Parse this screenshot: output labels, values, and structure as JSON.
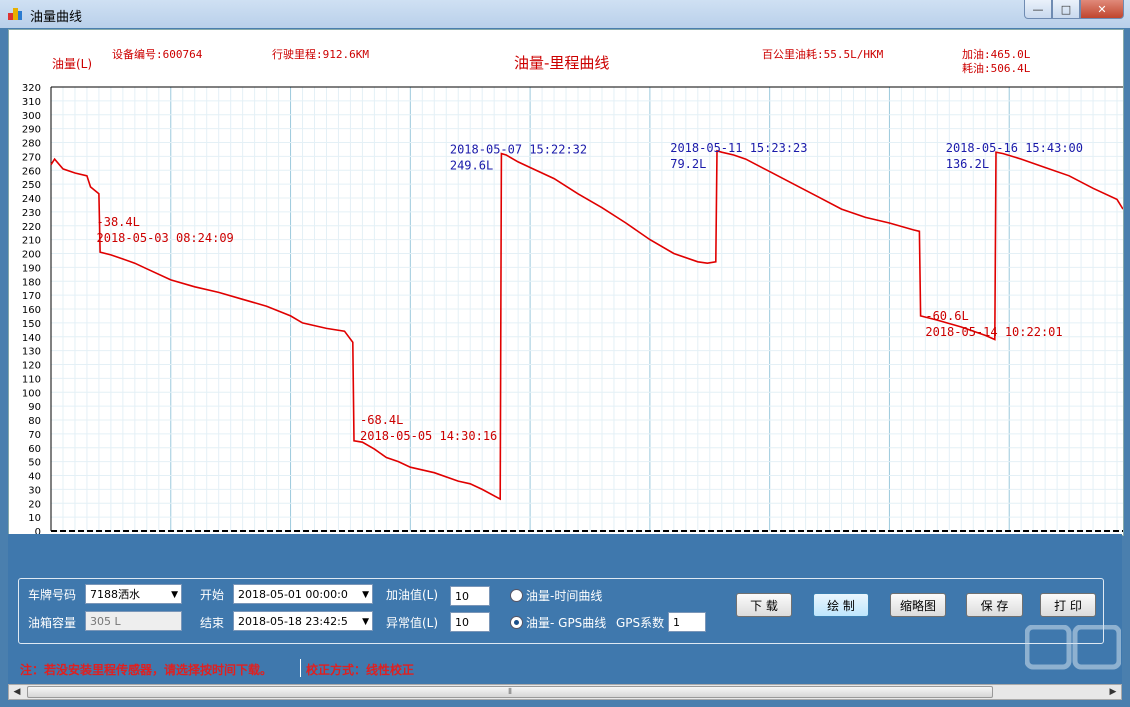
{
  "window": {
    "title": "油量曲线",
    "buttons": {
      "minimize": "—",
      "maximize": "□",
      "close": "✕"
    }
  },
  "header": {
    "y_unit_label": "油量(L)",
    "device": "设备编号:600764",
    "mileage": "行驶里程:912.6KM",
    "chart_title": "油量-里程曲线",
    "consumption": "百公里油耗:55.5L/HKM",
    "refuel_total": "加油:465.0L",
    "used_total": "耗油:506.4L"
  },
  "chart_data": {
    "type": "line",
    "xlim": [
      0,
      895
    ],
    "ylim": [
      0,
      320
    ],
    "x_ticks": [
      0,
      100,
      200,
      300,
      400,
      500,
      600,
      700,
      800
    ],
    "y_ticks": [
      0,
      10,
      20,
      30,
      40,
      50,
      60,
      70,
      80,
      90,
      100,
      110,
      120,
      130,
      140,
      150,
      160,
      170,
      180,
      190,
      200,
      210,
      220,
      230,
      240,
      250,
      260,
      270,
      280,
      290,
      300,
      310,
      320
    ],
    "grid": true,
    "line_color": "#e00000",
    "series": [
      {
        "x": [
          0,
          3,
          10,
          20,
          30,
          33,
          40,
          41,
          50,
          60,
          70,
          80,
          100,
          120,
          140,
          160,
          180,
          200,
          210,
          230,
          245,
          252,
          253,
          260,
          270,
          280,
          290,
          300,
          320,
          340,
          350,
          360,
          375,
          376,
          380,
          390,
          400,
          420,
          440,
          460,
          480,
          500,
          520,
          540,
          548,
          555,
          556,
          560,
          570,
          580,
          600,
          620,
          640,
          660,
          680,
          700,
          720,
          725,
          726,
          740,
          760,
          780,
          788,
          789,
          795,
          810,
          830,
          850,
          870,
          890,
          895
        ],
        "y": [
          264,
          268,
          261,
          258,
          256,
          248,
          243,
          201,
          199,
          196,
          193,
          189,
          181,
          176,
          172,
          167,
          162,
          155,
          150,
          146,
          144,
          136,
          65,
          64,
          59,
          53,
          50,
          46,
          42,
          36,
          34,
          30,
          23,
          272,
          271,
          266,
          262,
          254,
          243,
          233,
          222,
          210,
          200,
          194,
          193,
          194,
          274,
          273,
          271,
          268,
          259,
          250,
          241,
          232,
          226,
          222,
          217,
          216,
          155,
          152,
          147,
          141,
          138,
          273,
          272,
          268,
          262,
          256,
          247,
          239,
          232
        ]
      }
    ],
    "annotations": [
      {
        "x": 38,
        "y": 220,
        "color": "#cc0000",
        "lines": [
          "-38.4L",
          "2018-05-03 08:24:09"
        ]
      },
      {
        "x": 258,
        "y": 77,
        "color": "#cc0000",
        "lines": [
          "-68.4L",
          "2018-05-05 14:30:16"
        ]
      },
      {
        "x": 333,
        "y": 272,
        "color": "#1a1aaa",
        "lines": [
          "2018-05-07 15:22:32",
          "249.6L"
        ]
      },
      {
        "x": 517,
        "y": 273,
        "color": "#1a1aaa",
        "lines": [
          "2018-05-11 15:23:23",
          "79.2L"
        ]
      },
      {
        "x": 730,
        "y": 152,
        "color": "#cc0000",
        "lines": [
          "-60.6L",
          "2018-05-14 10:22:01"
        ]
      },
      {
        "x": 747,
        "y": 273,
        "color": "#1a1aaa",
        "lines": [
          "2018-05-16 15:43:00",
          "136.2L"
        ]
      }
    ]
  },
  "controls": {
    "plate_label": "车牌号码",
    "plate_value": "7188洒水",
    "tank_label": "油箱容量",
    "tank_value": "305 L",
    "start_label": "开始",
    "start_value": "2018-05-01 00:00:0",
    "end_label": "结束",
    "end_value": "2018-05-18 23:42:5",
    "refuel_label": "加油值(L)",
    "refuel_value": "10",
    "abnormal_label": "异常值(L)",
    "abnormal_value": "10",
    "radio_time": "油量-时间曲线",
    "radio_gps": "油量- GPS曲线",
    "gps_coef_label": "GPS系数",
    "gps_coef_value": "1",
    "btn_download": "下 载",
    "btn_draw": "绘 制",
    "btn_thumbnail": "缩略图",
    "btn_save": "保 存",
    "btn_print": "打 印"
  },
  "status": {
    "note": "注：若没安装里程传感器，请选择按时间下载。",
    "calibration": "校正方式：线性校正"
  },
  "colors": {
    "panel_bg": "#3f78ad",
    "curve": "#e00000",
    "refuel_label": "#1a1aaa",
    "drain_label": "#cc0000"
  }
}
